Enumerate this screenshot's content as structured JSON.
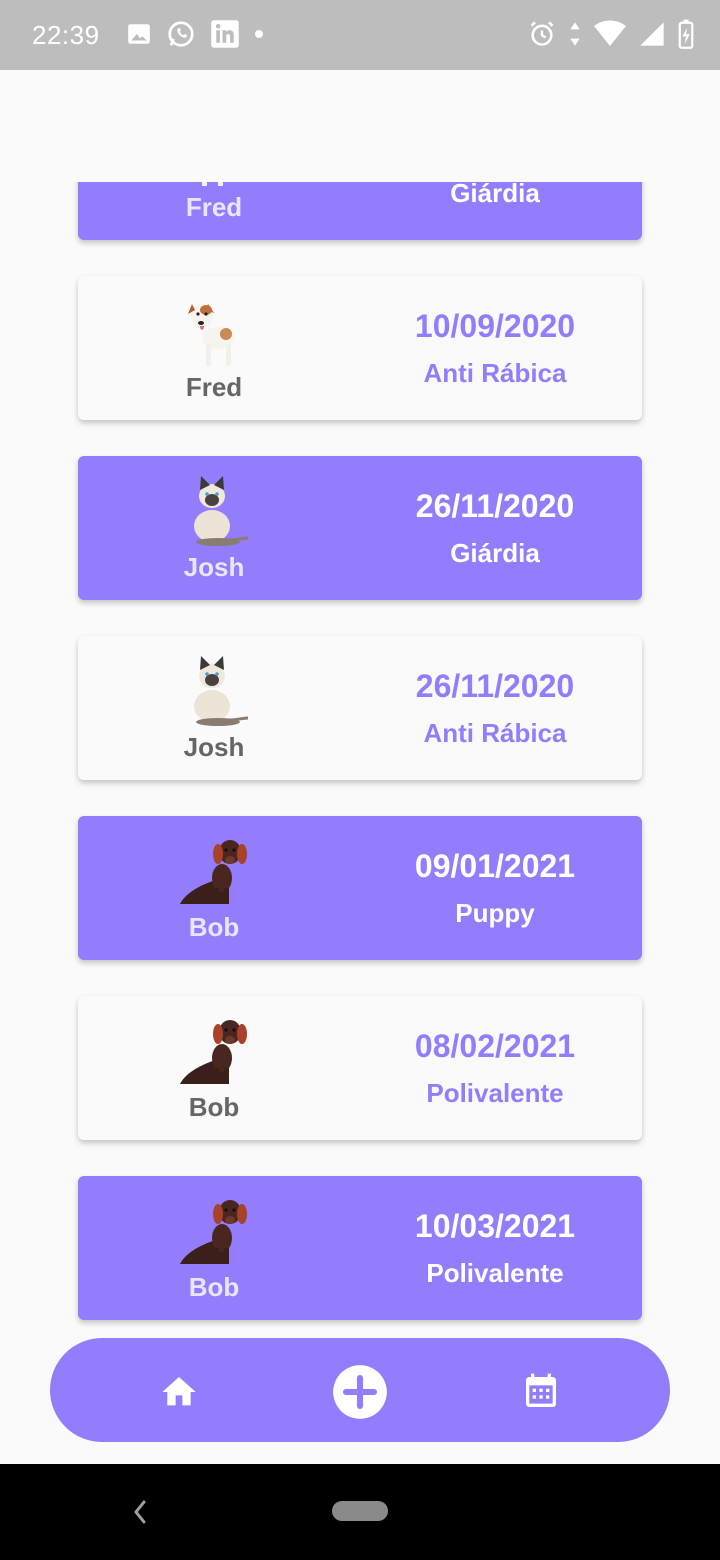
{
  "status_bar": {
    "time": "22:39",
    "left_icons": [
      "image-icon",
      "whatsapp-icon",
      "linkedin-icon",
      "dot-icon"
    ],
    "right_icons": [
      "alarm-icon",
      "data-arrows-icon",
      "wifi-icon",
      "cell-signal-icon",
      "battery-charging-icon"
    ]
  },
  "theme": {
    "accent": "#937dfd",
    "card_white": "#fafafa",
    "name_on_white": "#666666",
    "name_on_purple": "#ebe5ff"
  },
  "vaccines": [
    {
      "pet": "Fred",
      "pet_icon": "dog-jack-russell-icon",
      "date": "",
      "vaccine": "Giárdia",
      "style": "purple"
    },
    {
      "pet": "Fred",
      "pet_icon": "dog-jack-russell-icon",
      "date": "10/09/2020",
      "vaccine": "Anti Rábica",
      "style": "white"
    },
    {
      "pet": "Josh",
      "pet_icon": "cat-siamese-icon",
      "date": "26/11/2020",
      "vaccine": "Giárdia",
      "style": "purple"
    },
    {
      "pet": "Josh",
      "pet_icon": "cat-siamese-icon",
      "date": "26/11/2020",
      "vaccine": "Anti Rábica",
      "style": "white"
    },
    {
      "pet": "Bob",
      "pet_icon": "dog-dachshund-icon",
      "date": "09/01/2021",
      "vaccine": "Puppy",
      "style": "purple"
    },
    {
      "pet": "Bob",
      "pet_icon": "dog-dachshund-icon",
      "date": "08/02/2021",
      "vaccine": "Polivalente",
      "style": "white"
    },
    {
      "pet": "Bob",
      "pet_icon": "dog-dachshund-icon",
      "date": "10/03/2021",
      "vaccine": "Polivalente",
      "style": "purple"
    }
  ],
  "bottom_nav": {
    "items": [
      "home-icon",
      "add-circle-icon",
      "calendar-icon"
    ]
  },
  "system_nav": {
    "items": [
      "back-icon",
      "home-pill"
    ]
  }
}
